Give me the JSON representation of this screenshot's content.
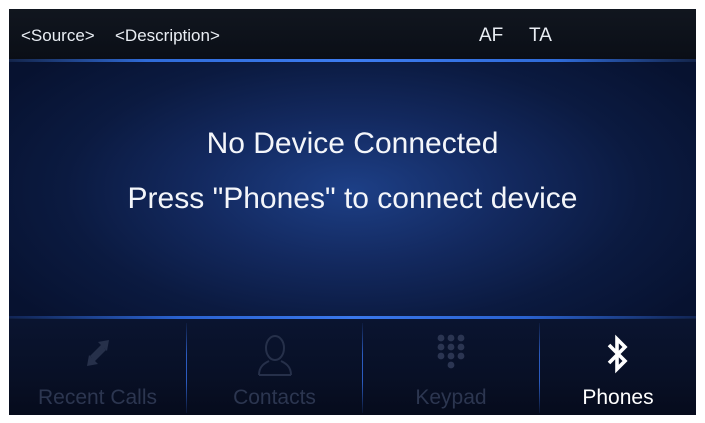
{
  "status_bar": {
    "source": "<Source>",
    "description": "<Description>",
    "af": "AF",
    "ta": "TA"
  },
  "message": {
    "line1": "No Device Connected",
    "line2": "Press \"Phones\" to connect device"
  },
  "nav": {
    "items": [
      {
        "label": "Recent Calls",
        "icon": "recent-calls-icon",
        "enabled": false
      },
      {
        "label": "Contacts",
        "icon": "contact-person-icon",
        "enabled": false
      },
      {
        "label": "Keypad",
        "icon": "keypad-icon",
        "enabled": false
      },
      {
        "label": "Phones",
        "icon": "bluetooth-icon",
        "enabled": true
      }
    ]
  },
  "colors": {
    "accent_blue": "#3d7cf0",
    "text_bright": "#ffffff",
    "text_disabled": "#2c3650",
    "background": "#050a14"
  }
}
